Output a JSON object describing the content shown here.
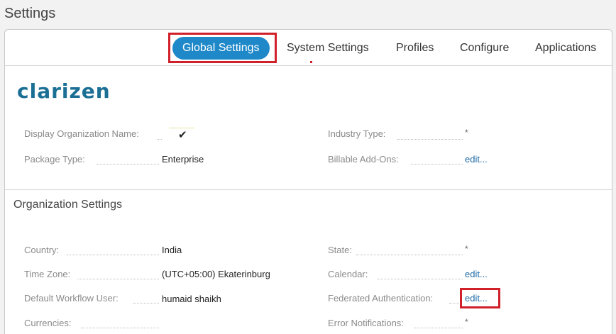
{
  "page_title": "Settings",
  "tabs": [
    {
      "label": "Global Settings",
      "active": true
    },
    {
      "label": "System Settings"
    },
    {
      "label": "Profiles"
    },
    {
      "label": "Configure"
    },
    {
      "label": "Applications"
    }
  ],
  "logo_text": "clarizen",
  "general": {
    "display_org_name_label": "Display Organization Name:",
    "display_org_name_checked": "✔",
    "package_type_label": "Package Type:",
    "package_type_value": "Enterprise",
    "industry_type_label": "Industry Type:",
    "billable_addons_label": "Billable Add-Ons:",
    "billable_addons_link": "edit..."
  },
  "org_settings": {
    "title": "Organization Settings",
    "country_label": "Country:",
    "country_value": "India",
    "timezone_label": "Time Zone:",
    "timezone_value": "(UTC+05:00) Ekaterinburg",
    "workflow_user_label": "Default Workflow User:",
    "workflow_user_value": "humaid shaikh",
    "currencies_label": "Currencies:",
    "state_label": "State:",
    "calendar_label": "Calendar:",
    "calendar_link": "edit...",
    "federated_auth_label": "Federated Authentication:",
    "federated_auth_link": "edit...",
    "error_notifications_label": "Error Notifications:"
  },
  "required_marker": "*",
  "colors": {
    "accent": "#1e88c9",
    "highlight": "#d0202a",
    "link": "#1f6aa5",
    "brand": "#1b6f95"
  }
}
